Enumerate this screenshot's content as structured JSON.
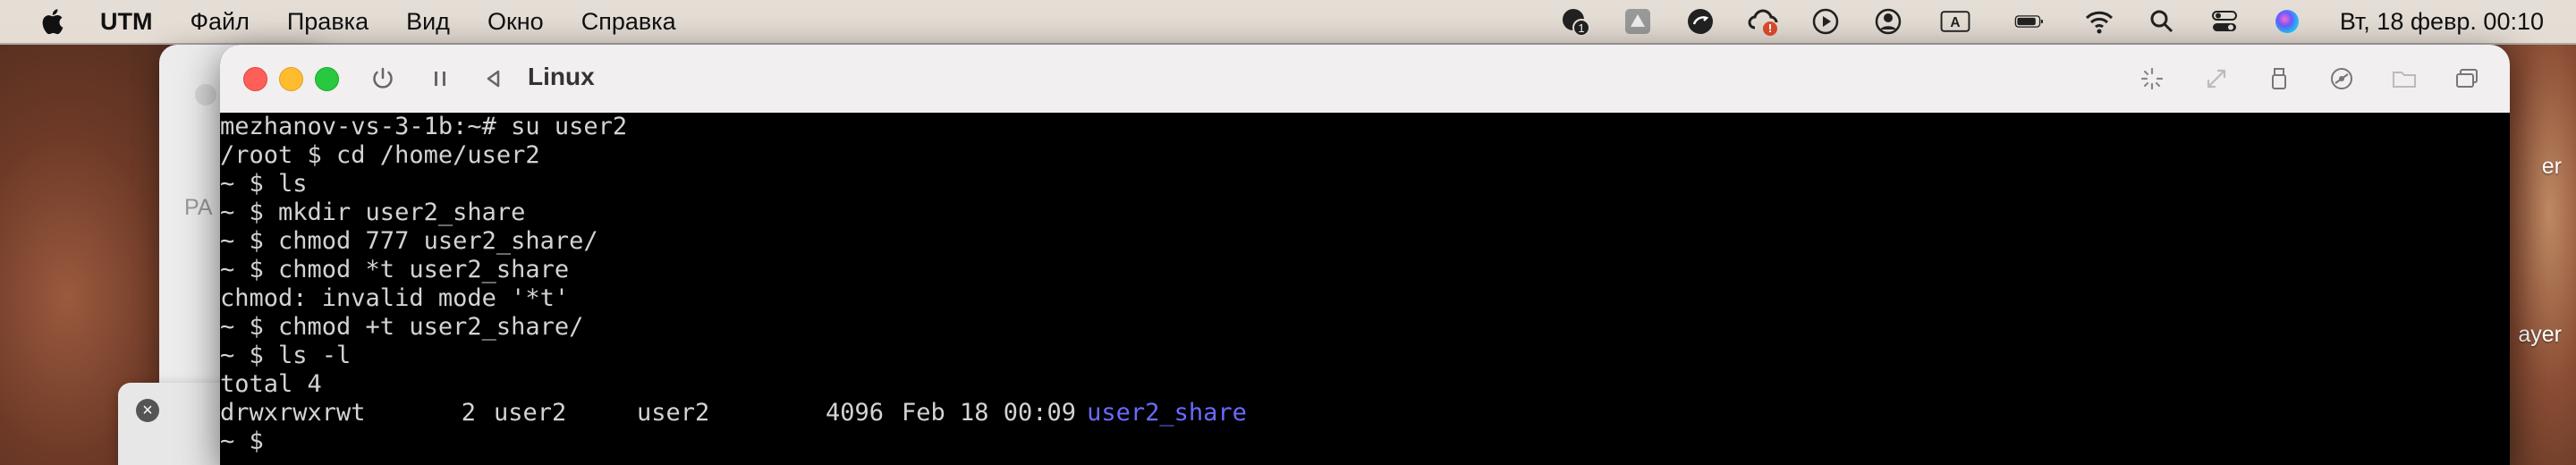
{
  "menubar": {
    "app": "UTM",
    "items": [
      "Файл",
      "Правка",
      "Вид",
      "Окно",
      "Справка"
    ],
    "status_icons": [
      "badge-1-icon",
      "google-drive-icon",
      "sync-icon",
      "creative-cloud-warning-icon",
      "play-circle-icon",
      "user-circle-icon",
      "input-source-icon",
      "battery-icon",
      "wifi-icon",
      "search-icon",
      "control-center-icon",
      "siri-icon"
    ],
    "badge_count": "1",
    "input_source": "A",
    "clock": "Вт, 18 февр.  00:10"
  },
  "background": {
    "window_label": "PA",
    "right_text_1": "er",
    "right_text_2": "ayer"
  },
  "window": {
    "title": "Linux"
  },
  "terminal": {
    "lines": [
      "mezhanov-vs-3-1b:~# su user2",
      "/root $ cd /home/user2",
      "~ $ ls",
      "~ $ mkdir user2_share",
      "~ $ chmod 777 user2_share/",
      "~ $ chmod *t user2_share",
      "chmod: invalid mode '*t'",
      "~ $ chmod +t user2_share/",
      "~ $ ls -l",
      "total 4"
    ],
    "ls_row": {
      "perms": "drwxrwxrwt",
      "links": "2",
      "owner": "user2",
      "group": "user2",
      "size": "4096",
      "date": "Feb 18 00:09",
      "name": "user2_share"
    },
    "prompt": "~ $"
  },
  "colors": {
    "dir_name": "#6a6aff",
    "terminal_fg": "#d3d3d3",
    "terminal_bg": "#000000"
  }
}
